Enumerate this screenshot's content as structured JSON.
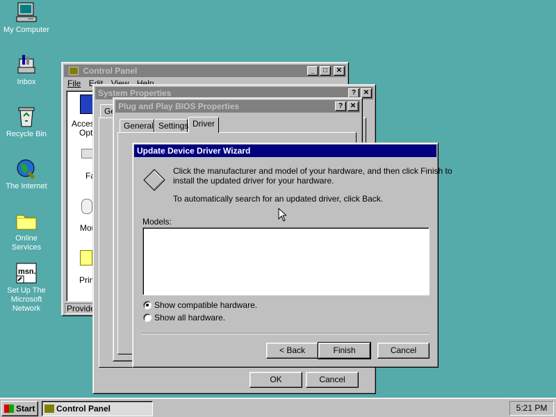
{
  "desktop": {
    "icons": [
      {
        "label": "My Computer",
        "icon": "my-computer-icon"
      },
      {
        "label": "Inbox",
        "icon": "inbox-icon"
      },
      {
        "label": "Recycle Bin",
        "icon": "recycle-bin-icon"
      },
      {
        "label": "The Internet",
        "icon": "internet-icon"
      },
      {
        "label": "Online\nServices",
        "icon": "folder-icon"
      },
      {
        "label": "Set Up The\nMicrosoft\nNetwork",
        "icon": "msn-icon"
      }
    ]
  },
  "control_panel": {
    "title": "Control Panel",
    "menu": [
      "File",
      "Edit",
      "View",
      "Help"
    ],
    "items": [
      "Access",
      "Opti",
      "Fa",
      "Mou",
      "Prin"
    ],
    "status_text": "Provide"
  },
  "system_properties": {
    "title": "System Properties",
    "tab_partial": "Ge",
    "ok_label": "OK",
    "cancel_label": "Cancel"
  },
  "pnp_bios": {
    "title": "Plug and Play BIOS Properties",
    "tabs": [
      "General",
      "Settings",
      "Driver"
    ]
  },
  "wizard": {
    "title": "Update Device Driver Wizard",
    "instruction_line1": "Click the manufacturer and model of your hardware, and then click Finish to",
    "instruction_line2": "install the updated driver for your hardware.",
    "auto_search_text": "To automatically search for an updated driver, click Back.",
    "models_label": "Models:",
    "radio_compatible": "Show compatible hardware.",
    "radio_all": "Show all hardware.",
    "back_label": "< Back",
    "finish_label": "Finish",
    "cancel_label": "Cancel"
  },
  "taskbar": {
    "start_label": "Start",
    "task_label": "Control Panel",
    "clock": "5:21 PM"
  },
  "colors": {
    "desktop": "#55aaaa",
    "active_title": "#000080",
    "inactive_title": "#808080",
    "face": "#c0c0c0"
  }
}
